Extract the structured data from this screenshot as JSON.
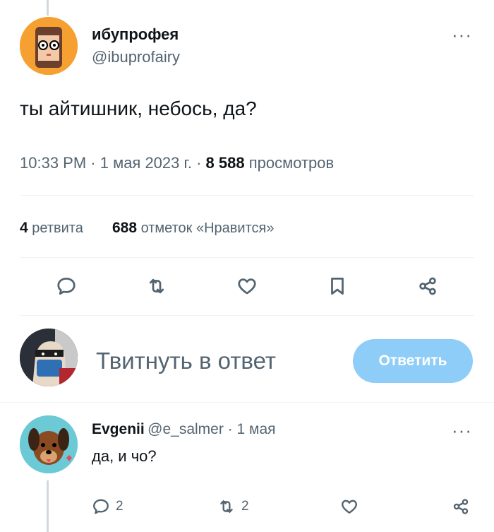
{
  "tweet": {
    "author_name": "ибупрофея",
    "author_handle": "@ibuprofairy",
    "more_label": "···",
    "text": "ты айтишник, небось, да?",
    "time": "10:33 PM · 1 мая 2023 г. · ",
    "views_count": "8 588",
    "views_label": " просмотров",
    "retweets_count": "4",
    "retweets_label": " ретвита",
    "likes_count": "688",
    "likes_label": " отметок «Нравится»",
    "actions": [
      "reply-icon",
      "retweet-icon",
      "like-icon",
      "bookmark-icon",
      "share-icon"
    ]
  },
  "composer": {
    "placeholder": "Твитнуть в ответ",
    "button_label": "Ответить",
    "button_color": "#8ecdf8"
  },
  "reply": {
    "author_name": "Evgenii",
    "author_handle": "@e_salmer · 1 мая",
    "more_label": "···",
    "text": "да, и чо?",
    "reply_count": "2",
    "retweet_count": "2"
  },
  "colors": {
    "muted": "#536471",
    "text": "#0f1419",
    "avatar1_bg": "#f5a031",
    "avatar3_bg": "#6cc9d6"
  }
}
